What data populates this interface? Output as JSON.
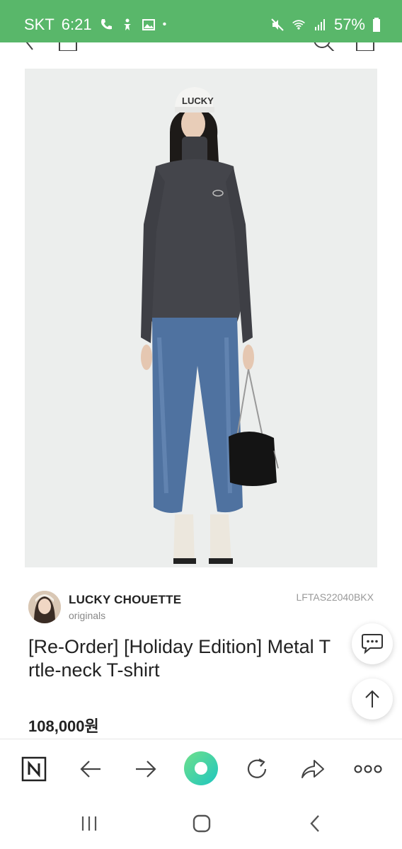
{
  "status_bar": {
    "carrier": "SKT",
    "time": "6:21",
    "battery": "57%"
  },
  "seller": {
    "name": "LUCKY CHOUETTE",
    "subtitle": "originals",
    "product_code": "LFTAS22040BKX"
  },
  "product": {
    "title": "[Re-Order] [Holiday Edition] Metal T\nrtle-neck T-shirt",
    "price": "108,000원",
    "cap_text": "LUCKY"
  },
  "icons": {
    "chat": "chat-bubble-icon",
    "top": "arrow-up-icon",
    "naver": "naver-n-icon",
    "back": "arrow-left-icon",
    "forward": "arrow-right-icon",
    "home": "green-circle-icon",
    "refresh": "refresh-icon",
    "share": "share-icon",
    "more": "more-dots-icon"
  },
  "colors": {
    "status_bar": "#59b76a",
    "accent": "#2fd3a0"
  }
}
